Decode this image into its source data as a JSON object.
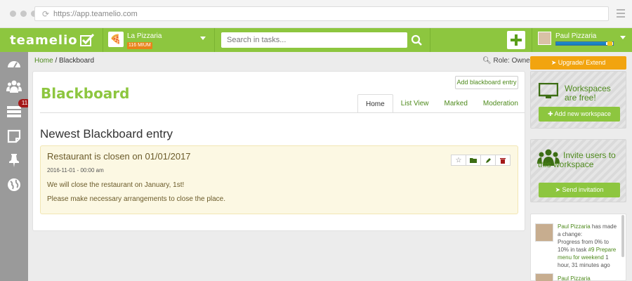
{
  "browser": {
    "url": "https://app.teamelio.com"
  },
  "topbar": {
    "logo_text": "teamelio",
    "organization": {
      "name": "La Pizzaria",
      "badge": "116 MIUM"
    },
    "search": {
      "placeholder": "Search in tasks..."
    },
    "user": {
      "name": "Paul Pizzaria",
      "progress": 0.88
    }
  },
  "leftnav": {
    "items": [
      {
        "icon": "dashboard-icon"
      },
      {
        "icon": "users-icon"
      },
      {
        "icon": "tasks-icon",
        "badge": "11"
      },
      {
        "icon": "note-icon"
      },
      {
        "icon": "pin-icon"
      },
      {
        "icon": "globe-icon"
      }
    ]
  },
  "breadcrumb": {
    "home": "Home",
    "separator": " / ",
    "current": "Blackboard"
  },
  "role": "Role: Owner",
  "page": {
    "title": "Blackboard",
    "add_button": "Add blackboard entry",
    "tabs": [
      {
        "label": "Home",
        "active": true
      },
      {
        "label": "List View",
        "active": false
      },
      {
        "label": "Marked",
        "active": false
      },
      {
        "label": "Moderation",
        "active": false
      }
    ],
    "section_title": "Newest Blackboard entry",
    "entry": {
      "title": "Restaurant is closen on 01/01/2017",
      "date": "2016-11-01 - 00:00 am",
      "lines": [
        "We will close the restaurant on January, 1st!",
        "Please make necessary arrangements to close the place."
      ]
    }
  },
  "sidebar_right": {
    "upgrade_label": "Upgrade/ Extend",
    "workspace_promo": {
      "title": "Workspaces are free!",
      "button": "Add new workspace"
    },
    "invite_promo": {
      "title": "Invite users to this workspace",
      "button": "Send invitation"
    },
    "activity": [
      {
        "user": "Paul Pizzaria",
        "text1": "has made a change:",
        "text2": "Progress",
        "text3": "from 0% to 10% in task",
        "task": "#9 Prepare menu for weekend",
        "time": "1 hour, 31 minutes ago"
      },
      {
        "user": "Paul Pizzaria"
      }
    ]
  },
  "colors": {
    "brand_green": "#8dc63f",
    "link_green": "#4e8a1c",
    "upgrade_orange": "#f2a40f",
    "badge_red": "#a41818"
  }
}
